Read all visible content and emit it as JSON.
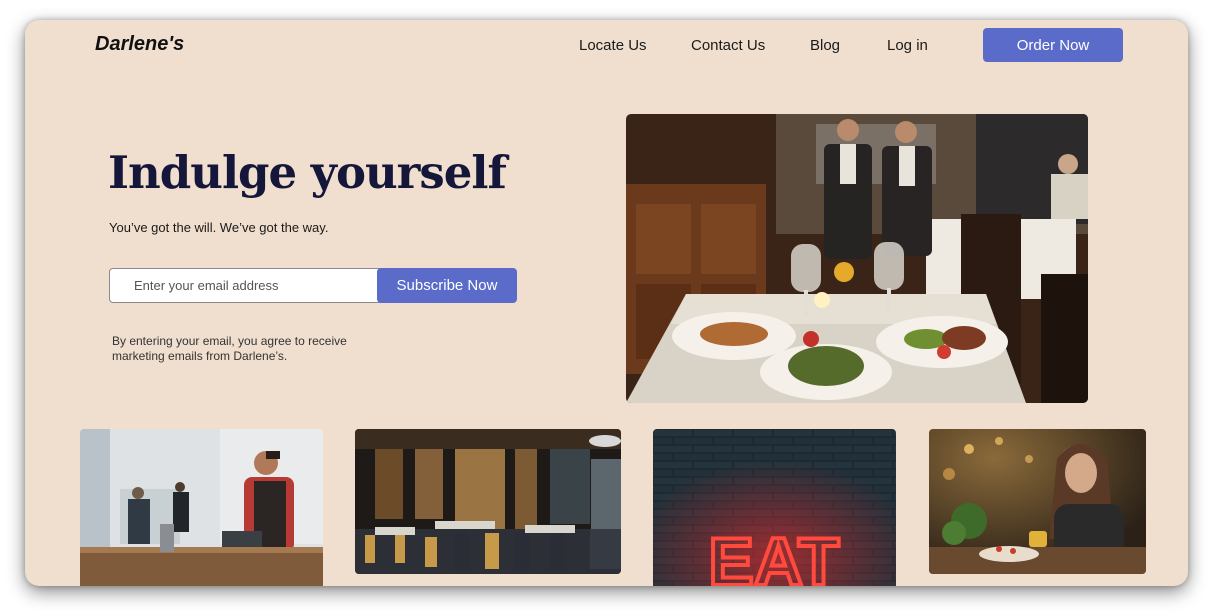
{
  "brand": {
    "name": "Darlene's"
  },
  "nav": {
    "links": [
      "Locate Us",
      "Contact Us",
      "Blog",
      "Log in"
    ],
    "cta_label": "Order Now"
  },
  "hero": {
    "headline": "Indulge yourself",
    "subhead": "You’ve got the will. We’ve got the way.",
    "email_placeholder": "Enter your email address",
    "subscribe_label": "Subscribe Now",
    "disclaimer": "By entering your email, you agree to receive marketing emails from Darlene’s."
  },
  "images": {
    "hero": "restaurant table with plated meals and waiters",
    "gallery": [
      "barista at counter",
      "restaurant dining room interior",
      "neon EAT sign on brick wall",
      "woman eating at cafe"
    ]
  },
  "neon_sign_text": "EAT",
  "colors": {
    "background": "#f0dfce",
    "accent": "#5b6bc9",
    "headline": "#14163a"
  }
}
